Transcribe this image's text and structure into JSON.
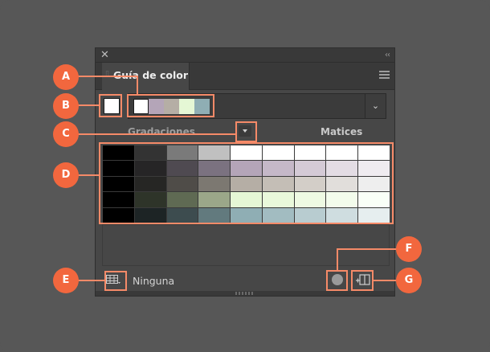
{
  "panel": {
    "tab_title": "Guía de color",
    "close_glyph": "✕",
    "collapse_glyph": "‹‹",
    "menu_icon": "hamburger-menu-icon",
    "current_color": "#ffffff",
    "harmony_colors": [
      "#ffffff",
      "#b4a5b8",
      "#b5aea5",
      "#e5f7d5",
      "#8faeb4"
    ],
    "dropdown_glyph": "⌄",
    "label_gradaciones": "Gradaciones",
    "label_matices": "Matices",
    "variation_grid": [
      [
        "#000000",
        "#333333",
        "#7a7a7a",
        "#c0c0c0",
        "#ffffff",
        "#ffffff",
        "#ffffff",
        "#ffffff",
        "#ffffff"
      ],
      [
        "#000000",
        "#262526",
        "#4f4a51",
        "#7b7280",
        "#b4a5b8",
        "#c5b8c8",
        "#d4cad6",
        "#e3dce4",
        "#efebf0"
      ],
      [
        "#000000",
        "#262624",
        "#4f4c48",
        "#7c7871",
        "#b5aea5",
        "#c4beb6",
        "#d3cec8",
        "#e1dedb",
        "#eeeeee"
      ],
      [
        "#000000",
        "#2e3429",
        "#5f6a53",
        "#9ba789",
        "#e5f7d5",
        "#e9f9db",
        "#eefae3",
        "#f3fcec",
        "#f9fff7"
      ],
      [
        "#000000",
        "#1d2425",
        "#3d4c4f",
        "#627a7e",
        "#8faeb4",
        "#a2bcc1",
        "#b8ccd0",
        "#cfdde0",
        "#e6eeef"
      ]
    ],
    "bottom_label": "Ninguna",
    "icons": {
      "limit_icon": "color-group-grid-icon",
      "swatch_icon": "edit-colors-icon",
      "save_icon": "save-to-swatches-icon"
    }
  },
  "callouts": {
    "a": "A",
    "b": "B",
    "c": "C",
    "d": "D",
    "e": "E",
    "f": "F",
    "g": "G",
    "color": "#f2673e"
  }
}
